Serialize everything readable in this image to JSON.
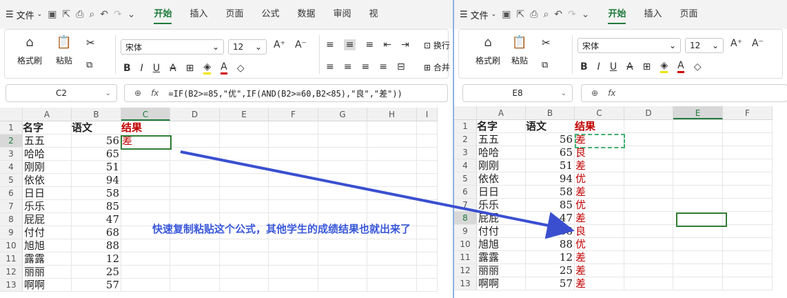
{
  "ribbon_tabs_left": [
    "开始",
    "插入",
    "页面",
    "公式",
    "数据",
    "审阅",
    "视"
  ],
  "ribbon_tabs_right": [
    "开始",
    "插入",
    "页面"
  ],
  "menu_label": "文件",
  "ribbon": {
    "format_painter": "格式刷",
    "paste": "粘贴",
    "font_name": "宋体",
    "font_size": "12",
    "wrap_text": "换行",
    "merge": "合并"
  },
  "left": {
    "name_box": "C2",
    "formula": "=IF(B2>=85,\"优\",IF(AND(B2>=60,B2<85),\"良\",\"差\"))",
    "columns": [
      "A",
      "B",
      "C",
      "D",
      "E",
      "F",
      "G",
      "H",
      "I"
    ],
    "header": {
      "a": "名字",
      "b": "语文",
      "c": "结果"
    },
    "rows": [
      {
        "n": "2",
        "name": "五五",
        "score": "56",
        "result": "差"
      },
      {
        "n": "3",
        "name": "哈哈",
        "score": "65",
        "result": ""
      },
      {
        "n": "4",
        "name": "刚刚",
        "score": "51",
        "result": ""
      },
      {
        "n": "5",
        "name": "依依",
        "score": "94",
        "result": ""
      },
      {
        "n": "6",
        "name": "日日",
        "score": "58",
        "result": ""
      },
      {
        "n": "7",
        "name": "乐乐",
        "score": "85",
        "result": ""
      },
      {
        "n": "8",
        "name": "屁屁",
        "score": "47",
        "result": ""
      },
      {
        "n": "9",
        "name": "付付",
        "score": "68",
        "result": ""
      },
      {
        "n": "10",
        "name": "旭旭",
        "score": "88",
        "result": ""
      },
      {
        "n": "11",
        "name": "露露",
        "score": "12",
        "result": ""
      },
      {
        "n": "12",
        "name": "丽丽",
        "score": "25",
        "result": ""
      },
      {
        "n": "13",
        "name": "啊啊",
        "score": "57",
        "result": ""
      }
    ]
  },
  "right": {
    "name_box": "E8",
    "formula": "",
    "columns": [
      "A",
      "B",
      "C",
      "D",
      "E",
      "F"
    ],
    "header": {
      "a": "名字",
      "b": "语文",
      "c": "结果"
    },
    "rows": [
      {
        "n": "2",
        "name": "五五",
        "score": "56",
        "result": "差"
      },
      {
        "n": "3",
        "name": "哈哈",
        "score": "65",
        "result": "良"
      },
      {
        "n": "4",
        "name": "刚刚",
        "score": "51",
        "result": "差"
      },
      {
        "n": "5",
        "name": "依依",
        "score": "94",
        "result": "优"
      },
      {
        "n": "6",
        "name": "日日",
        "score": "58",
        "result": "差"
      },
      {
        "n": "7",
        "name": "乐乐",
        "score": "85",
        "result": "优"
      },
      {
        "n": "8",
        "name": "屁屁",
        "score": "47",
        "result": "差"
      },
      {
        "n": "9",
        "name": "付付",
        "score": "68",
        "result": "良"
      },
      {
        "n": "10",
        "name": "旭旭",
        "score": "88",
        "result": "优"
      },
      {
        "n": "11",
        "name": "露露",
        "score": "12",
        "result": "差"
      },
      {
        "n": "12",
        "name": "丽丽",
        "score": "25",
        "result": "差"
      },
      {
        "n": "13",
        "name": "啊啊",
        "score": "57",
        "result": "差"
      }
    ]
  },
  "annotation": "快速复制粘贴这个公式，其他学生的成绩结果也就出来了",
  "colors": {
    "accent": "#1f7a3b",
    "result_red": "#c00000",
    "annotation_blue": "#3a58d8"
  }
}
